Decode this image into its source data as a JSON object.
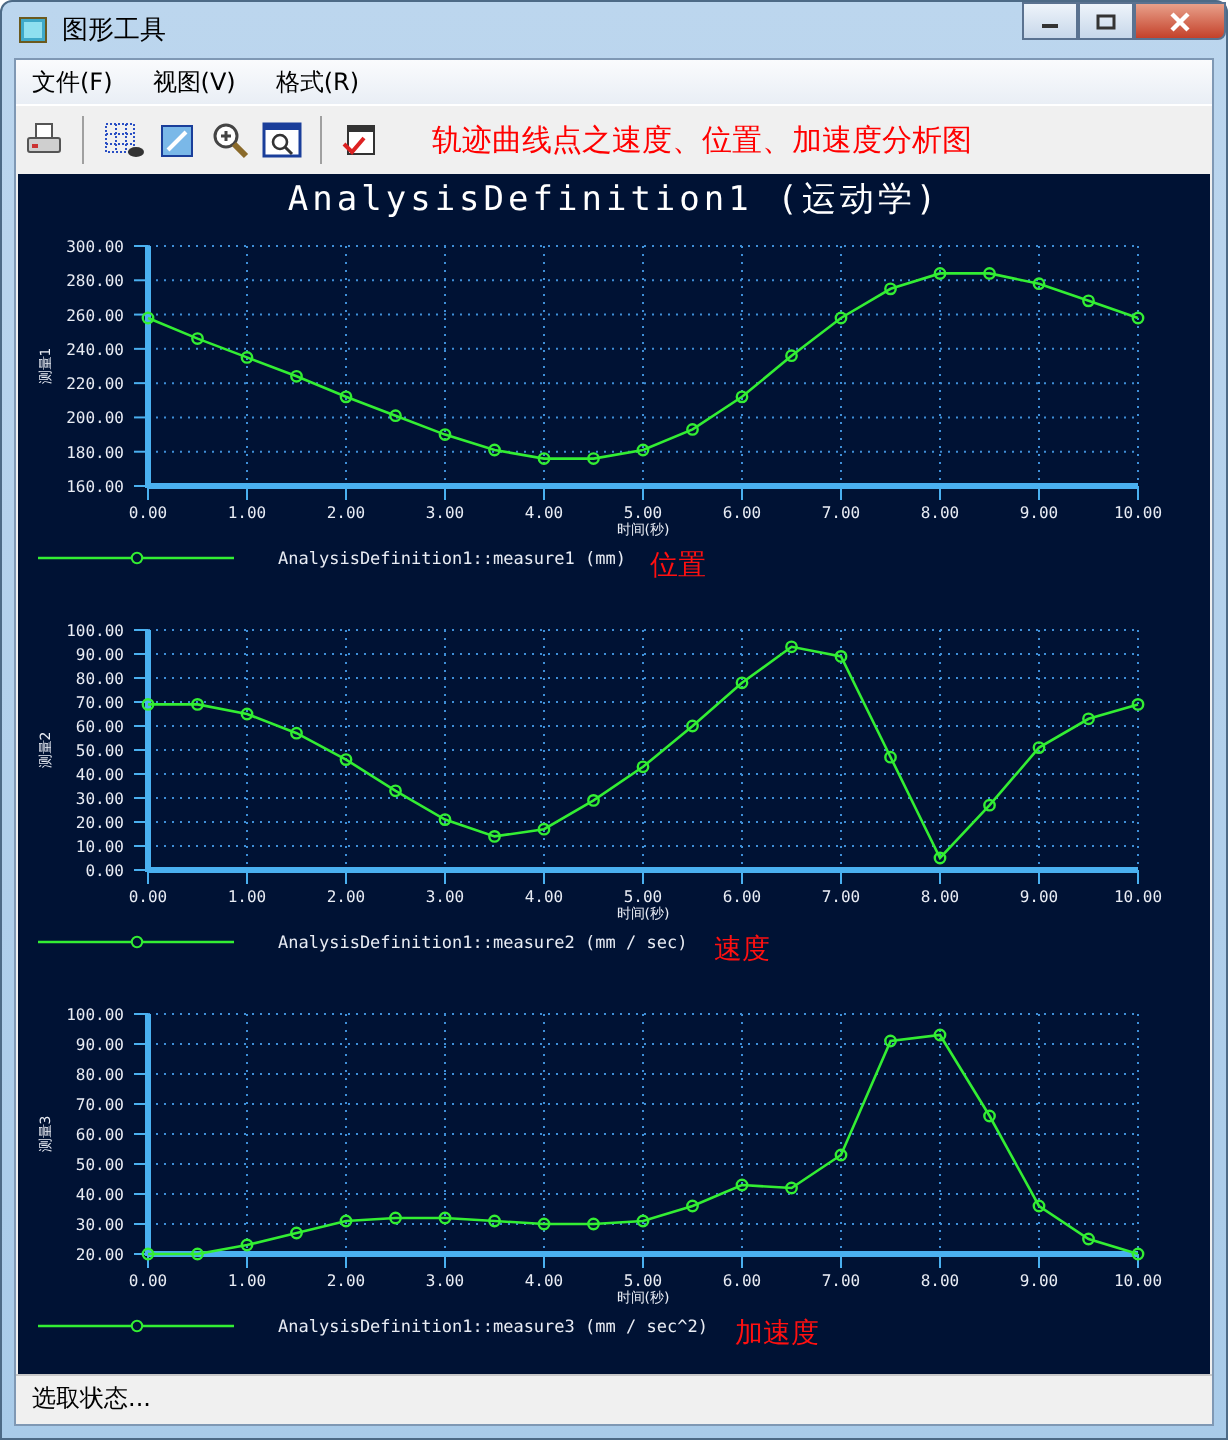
{
  "window": {
    "title": "图形工具"
  },
  "menu": [
    {
      "label": "文件(F)"
    },
    {
      "label": "视图(V)"
    },
    {
      "label": "格式(R)"
    }
  ],
  "toolbar": {
    "caption": "轨迹曲线点之速度、位置、加速度分析图"
  },
  "graph": {
    "title": "AnalysisDefinition1 (运动学)",
    "plots": [
      {
        "note": "位置",
        "chart_data": {
          "type": "line",
          "grid": true,
          "xlabel": "时间(秒)",
          "ylabel": "测量1",
          "xlim": [
            0,
            10
          ],
          "ylim": [
            160,
            300
          ],
          "x": [
            0,
            0.5,
            1,
            1.5,
            2,
            2.5,
            3,
            3.5,
            4,
            4.5,
            5,
            5.5,
            6,
            6.5,
            7,
            7.5,
            8,
            8.5,
            9,
            9.5,
            10
          ],
          "series": [
            {
              "name": "AnalysisDefinition1::measure1 (mm)",
              "color": "#33ee33",
              "marker": "circle",
              "values": [
                258,
                246,
                235,
                224,
                212,
                201,
                190,
                181,
                176,
                176,
                181,
                193,
                212,
                236,
                258,
                275,
                284,
                284,
                278,
                268,
                258
              ]
            }
          ],
          "xticks": [
            {
              "value": 0,
              "label": "0.00"
            },
            {
              "value": 1,
              "label": "1.00"
            },
            {
              "value": 2,
              "label": "2.00"
            },
            {
              "value": 3,
              "label": "3.00"
            },
            {
              "value": 4,
              "label": "4.00"
            },
            {
              "value": 5,
              "label": "5.00"
            },
            {
              "value": 6,
              "label": "6.00"
            },
            {
              "value": 7,
              "label": "7.00"
            },
            {
              "value": 8,
              "label": "8.00"
            },
            {
              "value": 9,
              "label": "9.00"
            },
            {
              "value": 10,
              "label": "10.00"
            }
          ],
          "yticks": [
            {
              "value": 160,
              "label": "160.00"
            },
            {
              "value": 180,
              "label": "180.00"
            },
            {
              "value": 200,
              "label": "200.00"
            },
            {
              "value": 220,
              "label": "220.00"
            },
            {
              "value": 240,
              "label": "240.00"
            },
            {
              "value": 260,
              "label": "260.00"
            },
            {
              "value": 280,
              "label": "280.00"
            },
            {
              "value": 300,
              "label": "300.00"
            }
          ]
        }
      },
      {
        "note": "速度",
        "chart_data": {
          "type": "line",
          "grid": true,
          "xlabel": "时间(秒)",
          "ylabel": "测量2",
          "xlim": [
            0,
            10
          ],
          "ylim": [
            0,
            100
          ],
          "x": [
            0,
            0.5,
            1,
            1.5,
            2,
            2.5,
            3,
            3.5,
            4,
            4.5,
            5,
            5.5,
            6,
            6.5,
            7,
            7.5,
            8,
            8.5,
            9,
            9.5,
            10
          ],
          "series": [
            {
              "name": "AnalysisDefinition1::measure2 (mm / sec)",
              "color": "#33ee33",
              "marker": "circle",
              "values": [
                69,
                69,
                65,
                57,
                46,
                33,
                21,
                14,
                17,
                29,
                43,
                60,
                78,
                93,
                89,
                47,
                5,
                27,
                51,
                63,
                69
              ]
            }
          ],
          "xticks": [
            {
              "value": 0,
              "label": "0.00"
            },
            {
              "value": 1,
              "label": "1.00"
            },
            {
              "value": 2,
              "label": "2.00"
            },
            {
              "value": 3,
              "label": "3.00"
            },
            {
              "value": 4,
              "label": "4.00"
            },
            {
              "value": 5,
              "label": "5.00"
            },
            {
              "value": 6,
              "label": "6.00"
            },
            {
              "value": 7,
              "label": "7.00"
            },
            {
              "value": 8,
              "label": "8.00"
            },
            {
              "value": 9,
              "label": "9.00"
            },
            {
              "value": 10,
              "label": "10.00"
            }
          ],
          "yticks": [
            {
              "value": 0,
              "label": "0.00"
            },
            {
              "value": 10,
              "label": "10.00"
            },
            {
              "value": 20,
              "label": "20.00"
            },
            {
              "value": 30,
              "label": "30.00"
            },
            {
              "value": 40,
              "label": "40.00"
            },
            {
              "value": 50,
              "label": "50.00"
            },
            {
              "value": 60,
              "label": "60.00"
            },
            {
              "value": 70,
              "label": "70.00"
            },
            {
              "value": 80,
              "label": "80.00"
            },
            {
              "value": 90,
              "label": "90.00"
            },
            {
              "value": 100,
              "label": "100.00"
            }
          ]
        }
      },
      {
        "note": "加速度",
        "chart_data": {
          "type": "line",
          "grid": true,
          "xlabel": "时间(秒)",
          "ylabel": "测量3",
          "xlim": [
            0,
            10
          ],
          "ylim": [
            20,
            100
          ],
          "x": [
            0,
            0.5,
            1,
            1.5,
            2,
            2.5,
            3,
            3.5,
            4,
            4.5,
            5,
            5.5,
            6,
            6.5,
            7,
            7.5,
            8,
            8.5,
            9,
            9.5,
            10
          ],
          "series": [
            {
              "name": "AnalysisDefinition1::measure3 (mm / sec^2)",
              "color": "#33ee33",
              "marker": "circle",
              "values": [
                20,
                20,
                23,
                27,
                31,
                32,
                32,
                31,
                30,
                30,
                31,
                36,
                43,
                42,
                53,
                91,
                93,
                66,
                36,
                25,
                20
              ]
            }
          ],
          "xticks": [
            {
              "value": 0,
              "label": "0.00"
            },
            {
              "value": 1,
              "label": "1.00"
            },
            {
              "value": 2,
              "label": "2.00"
            },
            {
              "value": 3,
              "label": "3.00"
            },
            {
              "value": 4,
              "label": "4.00"
            },
            {
              "value": 5,
              "label": "5.00"
            },
            {
              "value": 6,
              "label": "6.00"
            },
            {
              "value": 7,
              "label": "7.00"
            },
            {
              "value": 8,
              "label": "8.00"
            },
            {
              "value": 9,
              "label": "9.00"
            },
            {
              "value": 10,
              "label": "10.00"
            }
          ],
          "yticks": [
            {
              "value": 20,
              "label": "20.00"
            },
            {
              "value": 30,
              "label": "30.00"
            },
            {
              "value": 40,
              "label": "40.00"
            },
            {
              "value": 50,
              "label": "50.00"
            },
            {
              "value": 60,
              "label": "60.00"
            },
            {
              "value": 70,
              "label": "70.00"
            },
            {
              "value": 80,
              "label": "80.00"
            },
            {
              "value": 90,
              "label": "90.00"
            },
            {
              "value": 100,
              "label": "100.00"
            }
          ]
        }
      }
    ]
  },
  "status_bar": "选取状态..."
}
